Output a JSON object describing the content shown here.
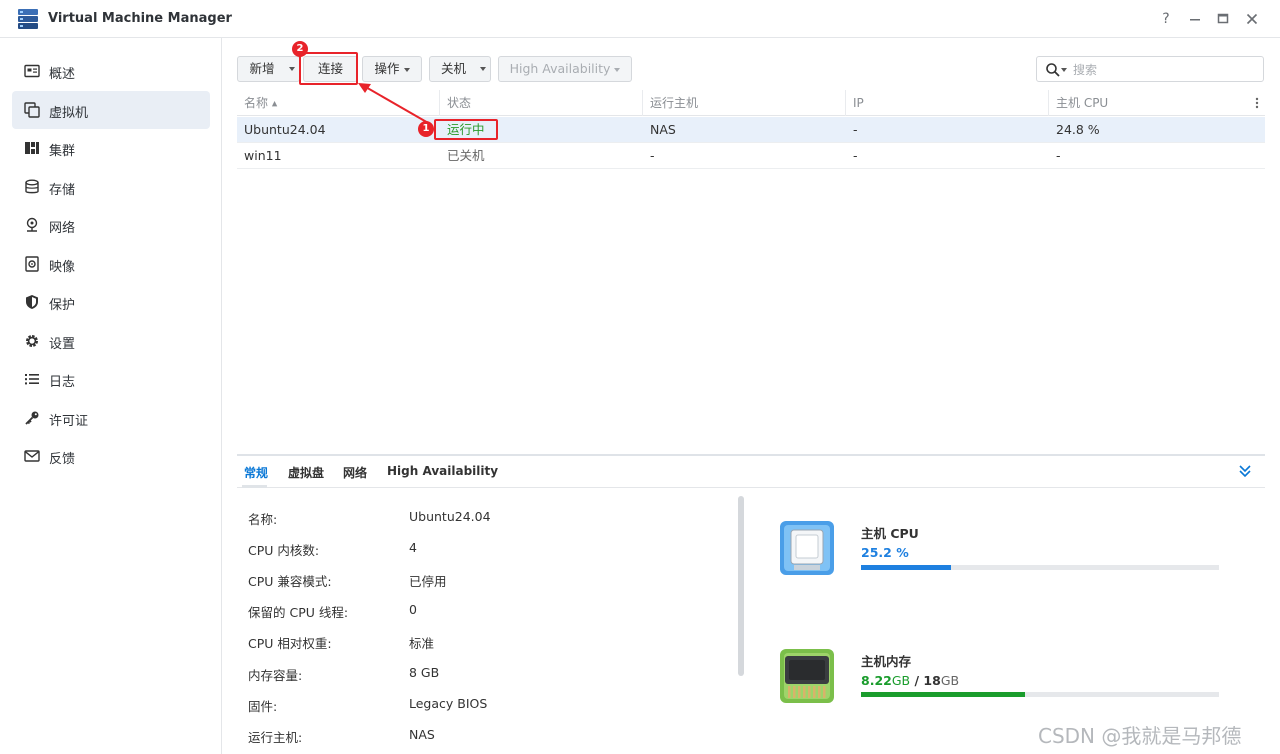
{
  "window": {
    "title": "Virtual Machine Manager",
    "controls": [
      "help-icon",
      "minimize-icon",
      "maximize-icon",
      "close-icon"
    ]
  },
  "sidebar": {
    "items": [
      {
        "label": "概述",
        "icon": "overview-icon",
        "active": false
      },
      {
        "label": "虚拟机",
        "icon": "vm-icon",
        "active": true
      },
      {
        "label": "集群",
        "icon": "cluster-icon",
        "active": false
      },
      {
        "label": "存储",
        "icon": "storage-icon",
        "active": false
      },
      {
        "label": "网络",
        "icon": "network-icon",
        "active": false
      },
      {
        "label": "映像",
        "icon": "image-icon",
        "active": false
      },
      {
        "label": "保护",
        "icon": "shield-icon",
        "active": false
      },
      {
        "label": "设置",
        "icon": "gear-icon",
        "active": false
      },
      {
        "label": "日志",
        "icon": "log-icon",
        "active": false
      },
      {
        "label": "许可证",
        "icon": "key-icon",
        "active": false
      },
      {
        "label": "反馈",
        "icon": "mail-icon",
        "active": false
      }
    ]
  },
  "toolbar": {
    "new_label": "新增",
    "connect_label": "连接",
    "action_label": "操作",
    "shutdown_label": "关机",
    "ha_label": "High Availability",
    "search_placeholder": "搜索"
  },
  "table": {
    "columns": [
      "名称",
      "状态",
      "运行主机",
      "IP",
      "主机 CPU"
    ],
    "sort_indicator": "▲",
    "rows": [
      {
        "name": "Ubuntu24.04",
        "status": "运行中",
        "host": "NAS",
        "ip": "-",
        "cpu": "24.8 %",
        "selected": true
      },
      {
        "name": "win11",
        "status": "已关机",
        "host": "-",
        "ip": "-",
        "cpu": "-",
        "selected": false
      }
    ]
  },
  "detail": {
    "tabs": [
      "常规",
      "虚拟盘",
      "网络",
      "High Availability"
    ],
    "properties": [
      {
        "label": "名称:",
        "value": "Ubuntu24.04"
      },
      {
        "label": "CPU 内核数:",
        "value": "4"
      },
      {
        "label": "CPU 兼容模式:",
        "value": "已停用"
      },
      {
        "label": "保留的 CPU 线程:",
        "value": "0"
      },
      {
        "label": "CPU 相对权重:",
        "value": "标准"
      },
      {
        "label": "内存容量:",
        "value": "8 GB"
      },
      {
        "label": "固件:",
        "value": "Legacy BIOS"
      },
      {
        "label": "运行主机:",
        "value": "NAS"
      }
    ],
    "cpu": {
      "title": "主机 CPU",
      "value_text": "25.2 %",
      "percent": 25.2,
      "color": "#1e80e0"
    },
    "memory": {
      "title": "主机内存",
      "used": "8.22",
      "used_unit": "GB",
      "separator": "/",
      "total": "18",
      "total_unit": "GB",
      "percent": 45.7,
      "color": "#1a9c2c"
    }
  },
  "annotations": [
    {
      "number": "1",
      "target": "status-running"
    },
    {
      "number": "2",
      "target": "connect-button"
    }
  ],
  "watermark": "CSDN @我就是马邦德",
  "colors": {
    "accent": "#0a78d6",
    "annotation": "#e8232a",
    "running": "#2b9a2b",
    "selected_row": "#e8f0fa"
  }
}
